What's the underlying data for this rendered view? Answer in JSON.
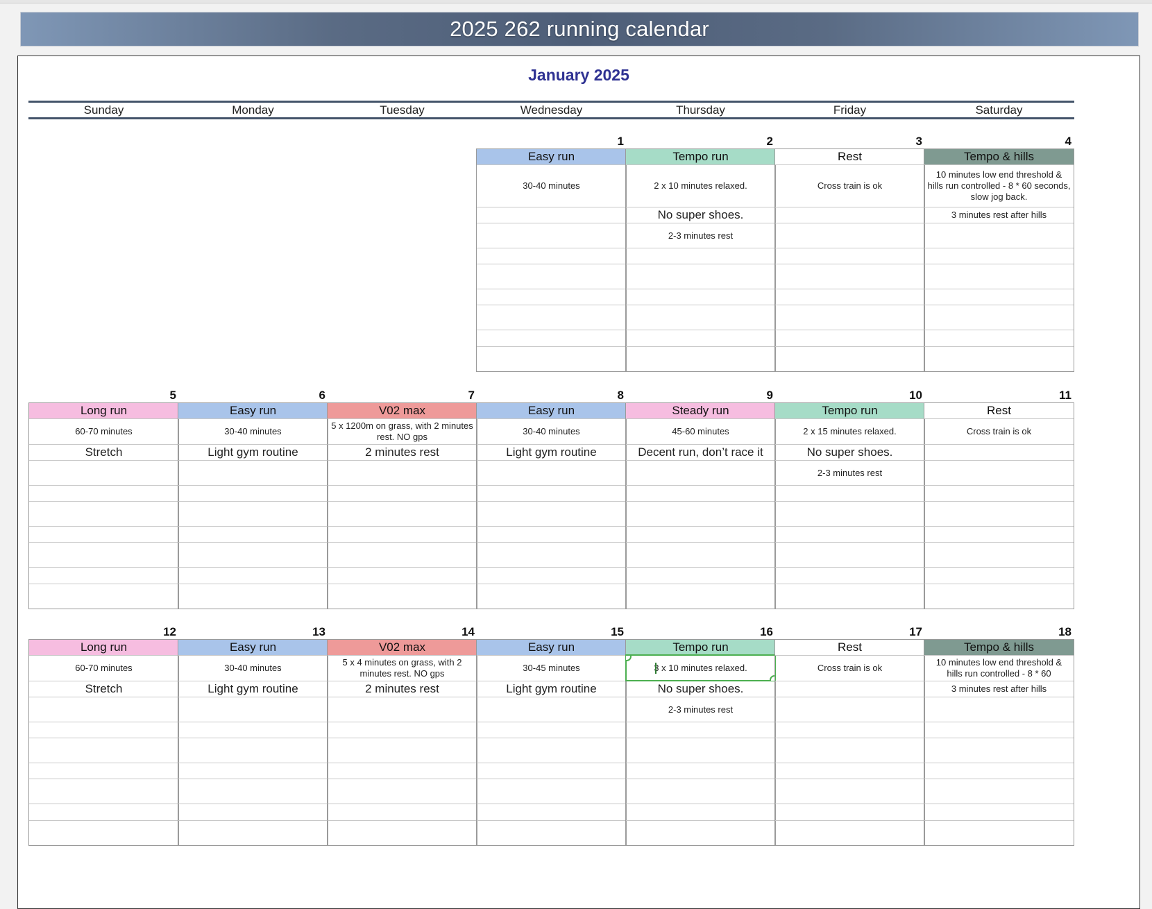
{
  "banner_title": "2025 262 running calendar",
  "month_title": "January 2025",
  "weekdays": [
    "Sunday",
    "Monday",
    "Tuesday",
    "Wednesday",
    "Thursday",
    "Friday",
    "Saturday"
  ],
  "colors": {
    "easy": "#a9c4ea",
    "tempo": "#a6dcc7",
    "long": "#f6bde0",
    "steady": "#f6bde0",
    "vo2": "#ee9a99",
    "hills": "#7f9a91",
    "rest": "#ffffff"
  },
  "weeks": [
    [
      null,
      null,
      null,
      {
        "num": "1",
        "type": "Easy run",
        "kind": "easy",
        "lines": [
          "30-40 minutes",
          "",
          ""
        ]
      },
      {
        "num": "2",
        "type": "Tempo run",
        "kind": "tempo",
        "lines": [
          "2 x 10 minutes relaxed.",
          "No super shoes.",
          "2-3 minutes rest"
        ]
      },
      {
        "num": "3",
        "type": "Rest",
        "kind": "rest",
        "lines": [
          "Cross train is ok",
          "",
          ""
        ]
      },
      {
        "num": "4",
        "type": "Tempo & hills",
        "kind": "hills",
        "lines": [
          "10 minutes low end threshold & hills run controlled - 8 * 60 seconds, slow jog back.",
          "3 minutes rest after hills",
          ""
        ]
      }
    ],
    [
      {
        "num": "5",
        "type": "Long run",
        "kind": "long",
        "lines": [
          "60-70 minutes",
          "Stretch",
          ""
        ]
      },
      {
        "num": "6",
        "type": "Easy run",
        "kind": "easy",
        "lines": [
          "30-40 minutes",
          "Light gym routine",
          ""
        ]
      },
      {
        "num": "7",
        "type": "V02 max",
        "kind": "vo2",
        "lines": [
          "5 x 1200m on grass, with 2 minutes rest. NO gps",
          "2 minutes rest",
          ""
        ]
      },
      {
        "num": "8",
        "type": "Easy run",
        "kind": "easy",
        "lines": [
          "30-40 minutes",
          "Light gym routine",
          ""
        ]
      },
      {
        "num": "9",
        "type": "Steady run",
        "kind": "steady",
        "lines": [
          "45-60 minutes",
          "Decent run, don’t race it",
          ""
        ]
      },
      {
        "num": "10",
        "type": "Tempo run",
        "kind": "tempo",
        "lines": [
          "2 x 15 minutes relaxed.",
          "No super shoes.",
          "2-3 minutes rest"
        ]
      },
      {
        "num": "11",
        "type": "Rest",
        "kind": "rest",
        "lines": [
          "Cross train is ok",
          "",
          ""
        ]
      }
    ],
    [
      {
        "num": "12",
        "type": "Long run",
        "kind": "long",
        "lines": [
          "60-70 minutes",
          "Stretch",
          ""
        ]
      },
      {
        "num": "13",
        "type": "Easy run",
        "kind": "easy",
        "lines": [
          "30-40 minutes",
          "Light gym routine",
          ""
        ]
      },
      {
        "num": "14",
        "type": "V02 max",
        "kind": "vo2",
        "lines": [
          "5 x 4 minutes on grass, with 2 minutes rest. NO gps",
          "2 minutes rest",
          ""
        ]
      },
      {
        "num": "15",
        "type": "Easy run",
        "kind": "easy",
        "lines": [
          "30-45 minutes",
          "Light gym routine",
          ""
        ]
      },
      {
        "num": "16",
        "type": "Tempo run",
        "kind": "tempo",
        "lines": [
          "3 x 10 minutes relaxed.",
          "No super shoes.",
          "2-3 minutes rest"
        ],
        "selected": true
      },
      {
        "num": "17",
        "type": "Rest",
        "kind": "rest",
        "lines": [
          "Cross train is ok",
          "",
          ""
        ]
      },
      {
        "num": "18",
        "type": "Tempo & hills",
        "kind": "hills",
        "lines": [
          "10 minutes low end threshold & hills run controlled - 8 * 60",
          "3 minutes rest after hills",
          ""
        ]
      }
    ]
  ]
}
